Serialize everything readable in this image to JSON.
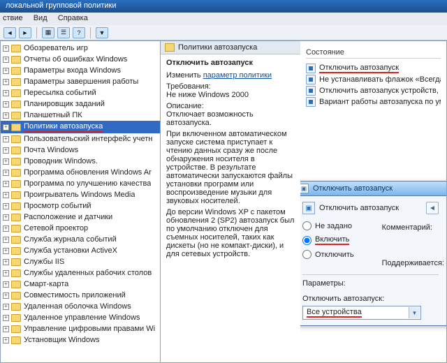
{
  "window": {
    "title": "локальной групповой политики"
  },
  "menu": {
    "action": "ствие",
    "view": "Вид",
    "help": "Справка"
  },
  "tree": {
    "items": [
      {
        "label": "Обозреватель игр"
      },
      {
        "label": "Отчеты об ошибках Windows"
      },
      {
        "label": "Параметры входа Windows"
      },
      {
        "label": "Параметры завершения работы"
      },
      {
        "label": "Пересылка событий"
      },
      {
        "label": "Планировщик заданий"
      },
      {
        "label": "Планшетный ПК"
      },
      {
        "label": "Политики автозапуска",
        "selected": true,
        "underline": true
      },
      {
        "label": "Пользовательский интерфейс учетн"
      },
      {
        "label": "Почта Windows"
      },
      {
        "label": "Проводник Windows."
      },
      {
        "label": "Программа обновления Windows Ar"
      },
      {
        "label": "Программа по улучшению качества"
      },
      {
        "label": "Проигрыватель Windows Media"
      },
      {
        "label": "Просмотр событий"
      },
      {
        "label": "Расположение и датчики"
      },
      {
        "label": "Сетевой проектор"
      },
      {
        "label": "Служба журнала событий"
      },
      {
        "label": "Служба установки ActiveX"
      },
      {
        "label": "Службы IIS"
      },
      {
        "label": "Службы удаленных рабочих столов"
      },
      {
        "label": "Смарт-карта"
      },
      {
        "label": "Совместимость приложений"
      },
      {
        "label": "Удаленная оболочка Windows"
      },
      {
        "label": "Удаленное управление Windows"
      },
      {
        "label": "Управление цифровыми правами Wi"
      },
      {
        "label": "Установщик Windows"
      }
    ]
  },
  "mid": {
    "header": "Политики автозапуска",
    "h1": "Отключить автозапуск",
    "change": "Изменить",
    "link": "параметр политики",
    "req_label": "Требования:",
    "req_value": "Не ниже Windows 2000",
    "desc_label": "Описание:",
    "desc1": "Отключает возможность автозапуска.",
    "desc2": "При включенном автоматическом запуске система приступает к чтению данных сразу же после обнаружения носителя в устройстве. В результате автоматически запускаются файлы установки программ или воспроизведение музыки для звуковых носителей.",
    "desc3": "До версии Windows XP с пакетом обновления 2 (SP2) автозапуск был по умолчанию отключен для съемных носителей, таких как дискеты (но не компакт-диски), и для сетевых устройств."
  },
  "right": {
    "col_state": "Состояние",
    "settings": [
      "Отключить автозапуск",
      "Не устанавливать флажок «Всегда вы",
      "Отключить автозапуск устройств, не",
      "Вариант работы автозапуска по умо."
    ],
    "underline_first": true
  },
  "dialog": {
    "title": "Отключить автозапуск",
    "label": "Отключить автозапуск",
    "radio_unset": "Не задано",
    "radio_on": "Включить",
    "radio_off": "Отключить",
    "comment_label": "Комментарий:",
    "support_label": "Поддерживается:",
    "params_label": "Параметры:",
    "field_label": "Отключить автозапуск:",
    "combo_value": "Все устройства",
    "selected": "on"
  }
}
